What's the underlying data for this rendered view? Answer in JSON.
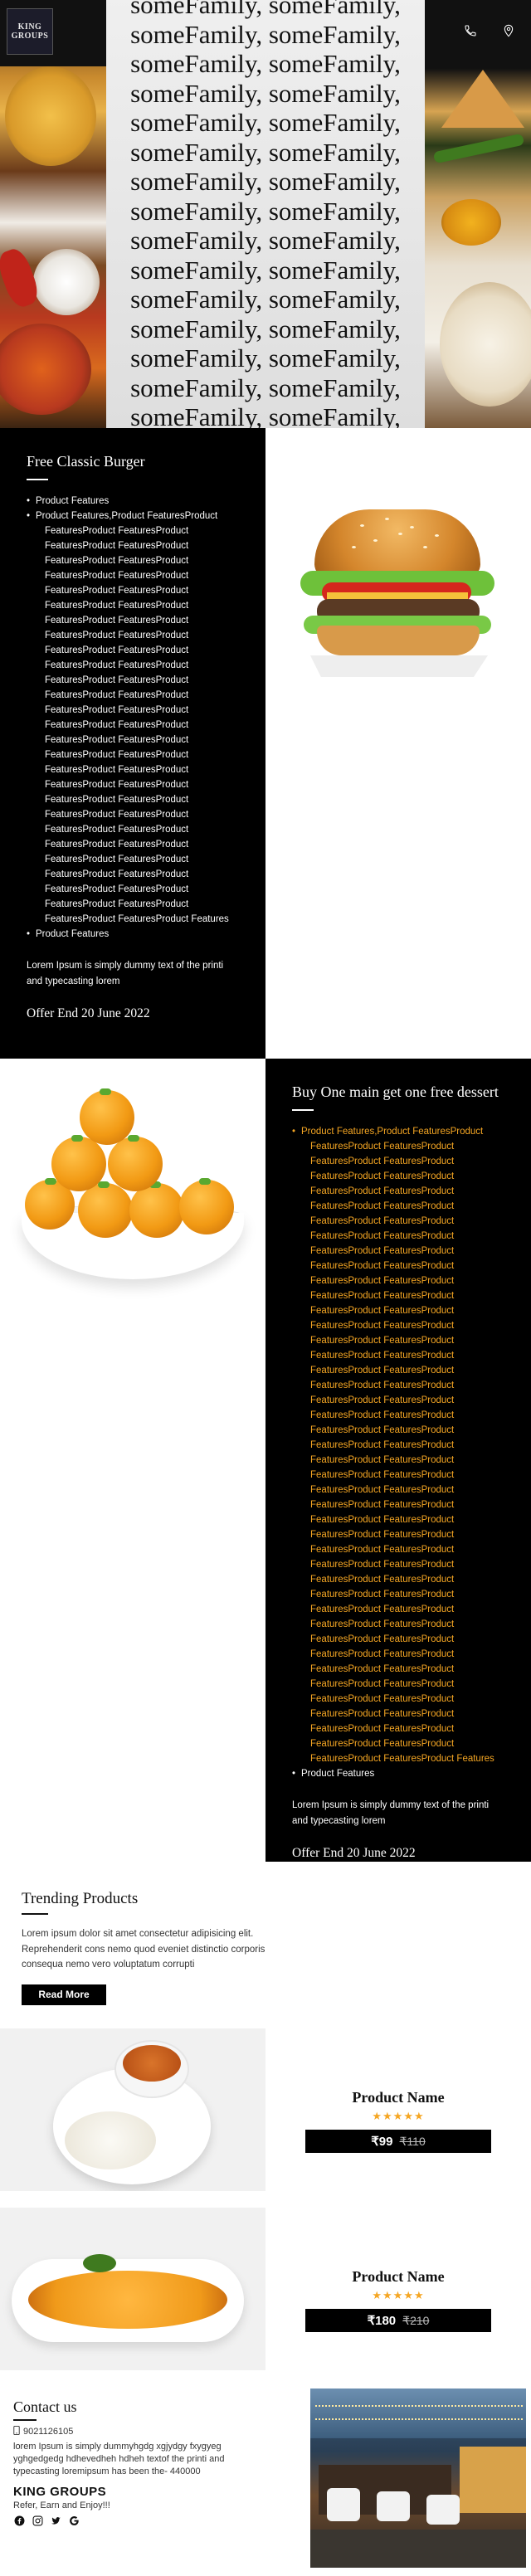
{
  "header": {
    "logo_line1": "KING",
    "logo_line2": "GROUPS",
    "phone_icon": "phone-icon",
    "location_icon": "location-pin-icon",
    "hero_text_lines": [
      "someFamily, someFamily,",
      "someFamily, someFamily,",
      "someFamily, someFamily,",
      "someFamily, someFamily,",
      "someFamily, someFamily,",
      "someFamily, someFamily,",
      "someFamily, someFamily,",
      "someFamily, someFamily,",
      "someFamily, someFamily,",
      "someFamily, someFamily,",
      "someFamily, someFamily,",
      "someFamily, someFamily,",
      "someFamily, someFamily,",
      "someFamily, someFamily,",
      "someFamily, someFamily,"
    ]
  },
  "promo1": {
    "title": "Free Classic Burger",
    "first_item": "Product Features",
    "long_first": "Product Features,Product FeaturesProduct",
    "long_lines": [
      "FeaturesProduct FeaturesProduct",
      "FeaturesProduct FeaturesProduct",
      "FeaturesProduct FeaturesProduct",
      "FeaturesProduct FeaturesProduct",
      "FeaturesProduct FeaturesProduct",
      "FeaturesProduct FeaturesProduct",
      "FeaturesProduct FeaturesProduct",
      "FeaturesProduct FeaturesProduct",
      "FeaturesProduct FeaturesProduct",
      "FeaturesProduct FeaturesProduct",
      "FeaturesProduct FeaturesProduct",
      "FeaturesProduct FeaturesProduct",
      "FeaturesProduct FeaturesProduct",
      "FeaturesProduct FeaturesProduct",
      "FeaturesProduct FeaturesProduct",
      "FeaturesProduct FeaturesProduct",
      "FeaturesProduct FeaturesProduct",
      "FeaturesProduct FeaturesProduct",
      "FeaturesProduct FeaturesProduct",
      "FeaturesProduct FeaturesProduct",
      "FeaturesProduct FeaturesProduct",
      "FeaturesProduct FeaturesProduct",
      "FeaturesProduct FeaturesProduct",
      "FeaturesProduct FeaturesProduct",
      "FeaturesProduct FeaturesProduct",
      "FeaturesProduct FeaturesProduct",
      "FeaturesProduct FeaturesProduct Features"
    ],
    "last_item": "Product Features",
    "description": "Lorem Ipsum is simply dummy text of the printi and typecasting lorem",
    "offer": "Offer End 20 June 2022"
  },
  "promo2": {
    "title": "Buy One main get one free dessert",
    "long_first": "Product Features,Product FeaturesProduct",
    "long_lines": [
      "FeaturesProduct FeaturesProduct",
      "FeaturesProduct FeaturesProduct",
      "FeaturesProduct FeaturesProduct",
      "FeaturesProduct FeaturesProduct",
      "FeaturesProduct FeaturesProduct",
      "FeaturesProduct FeaturesProduct",
      "FeaturesProduct FeaturesProduct",
      "FeaturesProduct FeaturesProduct",
      "FeaturesProduct FeaturesProduct",
      "FeaturesProduct FeaturesProduct",
      "FeaturesProduct FeaturesProduct",
      "FeaturesProduct FeaturesProduct",
      "FeaturesProduct FeaturesProduct",
      "FeaturesProduct FeaturesProduct",
      "FeaturesProduct FeaturesProduct",
      "FeaturesProduct FeaturesProduct",
      "FeaturesProduct FeaturesProduct",
      "FeaturesProduct FeaturesProduct",
      "FeaturesProduct FeaturesProduct",
      "FeaturesProduct FeaturesProduct",
      "FeaturesProduct FeaturesProduct",
      "FeaturesProduct FeaturesProduct",
      "FeaturesProduct FeaturesProduct",
      "FeaturesProduct FeaturesProduct",
      "FeaturesProduct FeaturesProduct",
      "FeaturesProduct FeaturesProduct",
      "FeaturesProduct FeaturesProduct",
      "FeaturesProduct FeaturesProduct",
      "FeaturesProduct FeaturesProduct",
      "FeaturesProduct FeaturesProduct",
      "FeaturesProduct FeaturesProduct",
      "FeaturesProduct FeaturesProduct",
      "FeaturesProduct FeaturesProduct",
      "FeaturesProduct FeaturesProduct",
      "FeaturesProduct FeaturesProduct",
      "FeaturesProduct FeaturesProduct",
      "FeaturesProduct FeaturesProduct",
      "FeaturesProduct FeaturesProduct",
      "FeaturesProduct FeaturesProduct",
      "FeaturesProduct FeaturesProduct",
      "FeaturesProduct FeaturesProduct",
      "FeaturesProduct FeaturesProduct Features"
    ],
    "last_item": "Product Features",
    "description": "Lorem Ipsum is simply dummy text of the printi and typecasting lorem",
    "offer": "Offer End 20 June 2022"
  },
  "trending": {
    "title": "Trending Products",
    "text": "Lorem ipsum dolor sit amet consectetur adipisicing elit. Reprehenderit cons nemo quod eveniet distinctio corporis consequa nemo vero voluptatum corrupti",
    "button": "Read More"
  },
  "products": [
    {
      "name": "Product Name",
      "stars": "★★★★★",
      "price": "₹99",
      "old_price": "₹110"
    },
    {
      "name": "Product Name",
      "stars": "★★★★★",
      "price": "₹180",
      "old_price": "₹210"
    }
  ],
  "contact": {
    "title": "Contact us",
    "phone": "9021126105",
    "description": "lorem Ipsum is simply dummyhgdg xgjydgy fxygyeg yghgedgedg hdhevedheh hdheh textof the printi and typecasting loremipsum has been the- 440000",
    "brand": "KING GROUPS",
    "tagline": "Refer, Earn and Enjoy!!!",
    "socials": [
      "facebook-icon",
      "instagram-icon",
      "twitter-icon",
      "google-icon"
    ]
  }
}
